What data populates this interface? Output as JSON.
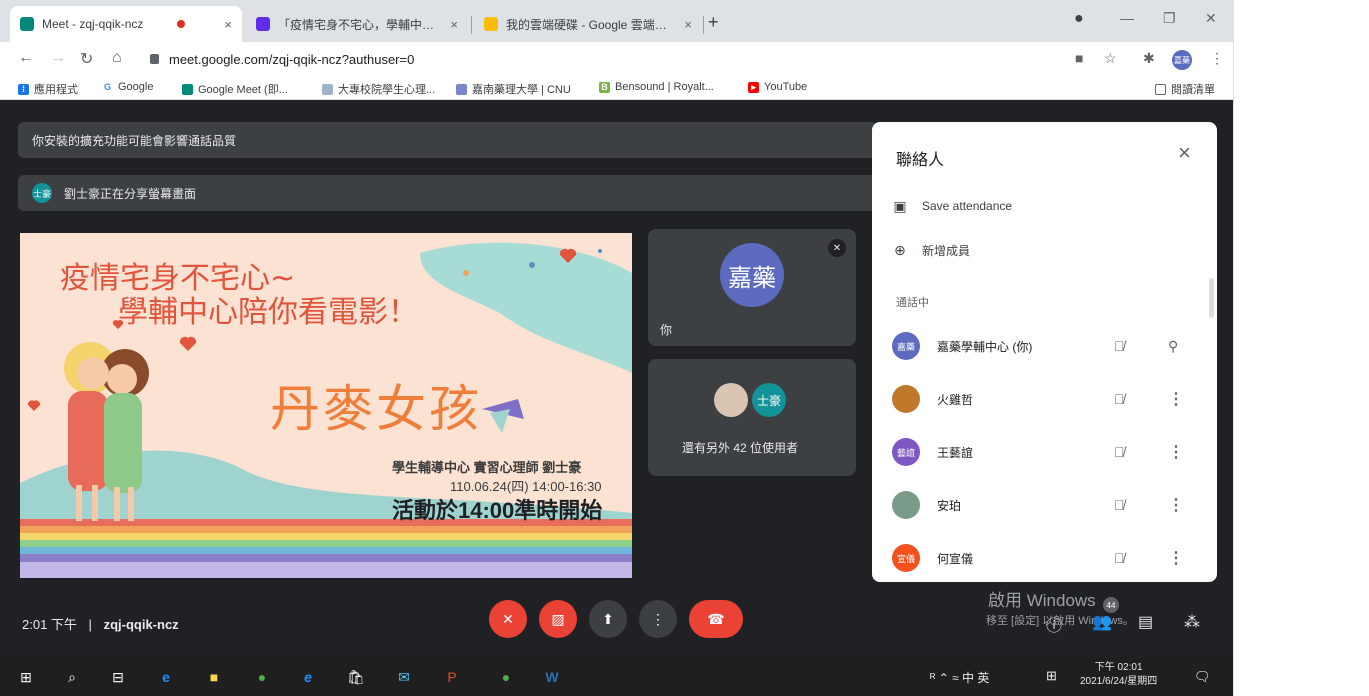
{
  "browser": {
    "tabs": [
      {
        "title": "Meet - zqj-qqik-ncz",
        "close": "×",
        "recording": true,
        "color": "#1a73e8"
      },
      {
        "title": "「疫情宅身不宅心，學輔中心陪",
        "close": "×",
        "color": "#5f2eea"
      },
      {
        "title": "我的雲端硬碟 - Google 雲端硬碟",
        "close": "×",
        "color": "#fbbc04"
      }
    ],
    "new_tab": "+",
    "url": "meet.google.com/zqj-qqik-ncz?authuser=0",
    "profile_initials": "嘉藥",
    "bookmarks": [
      {
        "label": "應用程式"
      },
      {
        "label": "Google"
      },
      {
        "label": "Google Meet (即..."
      },
      {
        "label": "大專校院學生心理..."
      },
      {
        "label": "嘉南藥理大學 | CNU"
      },
      {
        "label": "Bensound | Royalt..."
      },
      {
        "label": "YouTube"
      }
    ],
    "reading_list": "閱讀清單"
  },
  "meet": {
    "banner_extension": "你安裝的擴充功能可能會影響通話品質",
    "banner_presenting": "劉士豪正在分享螢幕畫面",
    "presenter_initials": "士豪",
    "slide": {
      "title_line1": "疫情宅身不宅心~",
      "title_line2": "學輔中心陪你看電影！",
      "movie": "丹麥女孩",
      "info1": "學生輔導中心  實習心理師  劉士豪",
      "info2": "110.06.24(四)  14:00-16:30",
      "info3": "活動於14:00準時開始"
    },
    "self_tile": {
      "avatar": "嘉藥",
      "name": "你"
    },
    "others_tile": {
      "avatar": "士豪",
      "text": "還有另外 42 位使用者"
    },
    "clock": "2:01 下午",
    "separator": "|",
    "meeting_code": "zqj-qqik-ncz",
    "participants_count": "44",
    "windows_activate": "啟用 Windows",
    "windows_activate_sub": "移至 [設定] 以啟用 Windows。"
  },
  "panel": {
    "title": "聯絡人",
    "close": "×",
    "save_attendance": "Save attendance",
    "add_people": "新增成員",
    "in_call": "通話中",
    "people": [
      {
        "name": "嘉藥學輔中心 (你)",
        "avatar": "嘉藥",
        "color": "#5c6bc0",
        "pin": true
      },
      {
        "name": "火雞哲",
        "avatar": "",
        "color": "#c0782a"
      },
      {
        "name": "王藝誼",
        "avatar": "藝誼",
        "color": "#7e57c2"
      },
      {
        "name": "安珀",
        "avatar": "",
        "color": "#7a9a8a"
      },
      {
        "name": "何宣儀",
        "avatar": "宣儀",
        "color": "#f4511e"
      }
    ]
  },
  "taskbar": {
    "tray": "ᴿ ⌃ ≈ 中 英",
    "time": "下午 02:01",
    "date": "2021/6/24/星期四"
  }
}
